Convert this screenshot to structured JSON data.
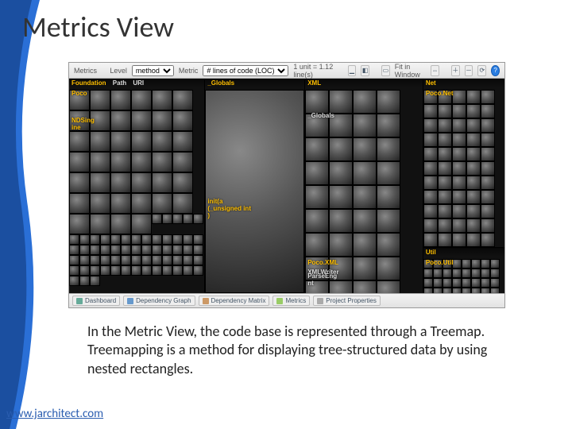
{
  "slide": {
    "title": "Metrics View",
    "body": "In the Metric View, the code base is represented through a Treemap. Treemapping is a method for displaying tree-structured data by using nested rectangles.",
    "footer_link": "www.jarchitect.com"
  },
  "app": {
    "panel_title": "Metrics",
    "toolbar": {
      "level_label": "Level",
      "level_value": "method",
      "metric_label": "Metric",
      "metric_value": "# lines of code (LOC)",
      "metric_hint": "1 unit = 1.12 line(s)",
      "fit_label": "Fit in Window",
      "icons": {
        "chart": "chart-icon",
        "color": "color-icon",
        "fit": "fit-icon",
        "zoom_in": "zoom-in-icon",
        "zoom_out": "zoom-out-icon",
        "reset": "reset-icon",
        "help": "help-icon"
      }
    },
    "columns": [
      {
        "header": "Foundation",
        "subs": [
          "Path",
          "URI"
        ],
        "extra": [
          "Poco",
          "NDSing\nine"
        ]
      },
      {
        "header": "_Globals",
        "subs": [],
        "mid": "init(a\n(_unsigned int\n)"
      },
      {
        "header": "XML",
        "subs": [],
        "extra_top": "_Globals",
        "extra_bot": [
          "Poco.XML",
          "XMLWriter",
          "ParseEng\nnt"
        ]
      },
      {
        "header": "Net",
        "subs": [],
        "extra": [
          "Poco.Net"
        ],
        "lower_header": "Util",
        "lower_extra": [
          "Poco.Util"
        ]
      }
    ],
    "bottom_tabs": [
      "Dashboard",
      "Dependency Graph",
      "Dependency Matrix",
      "Metrics",
      "Project Properties"
    ]
  }
}
